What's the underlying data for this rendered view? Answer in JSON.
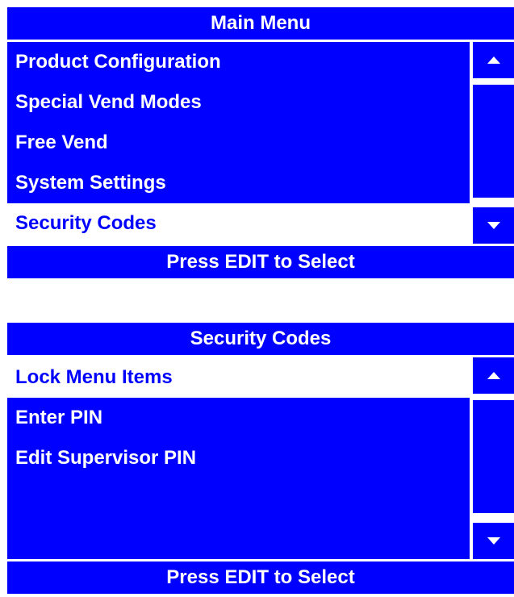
{
  "main_menu": {
    "title": "Main Menu",
    "items": [
      {
        "label": "Product Configuration",
        "selected": false
      },
      {
        "label": "Special Vend Modes",
        "selected": false
      },
      {
        "label": "Free Vend",
        "selected": false
      },
      {
        "label": "System Settings",
        "selected": false
      },
      {
        "label": "Security Codes",
        "selected": true
      }
    ],
    "footer": "Press EDIT to Select"
  },
  "security_codes": {
    "title": "Security Codes",
    "items": [
      {
        "label": "Lock Menu Items",
        "selected": true
      },
      {
        "label": "Enter PIN",
        "selected": false
      },
      {
        "label": "Edit Supervisor PIN",
        "selected": false
      },
      {
        "label": "",
        "selected": false
      }
    ],
    "footer": "Press EDIT to Select"
  },
  "icons": {
    "scroll_up": "up-triangle-icon",
    "scroll_down": "down-triangle-icon"
  },
  "colors": {
    "accent": "#0000ff",
    "text_on_accent": "#ffffff",
    "background": "#ffffff"
  }
}
